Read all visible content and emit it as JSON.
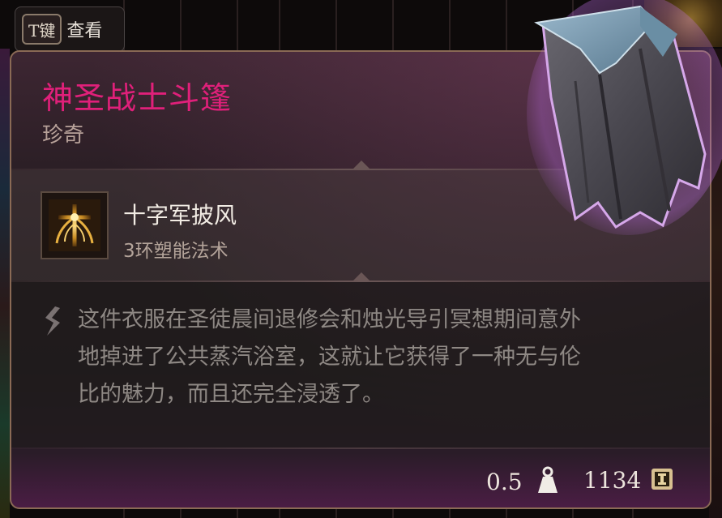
{
  "key_hint": {
    "key": "T键",
    "action": "查看"
  },
  "item": {
    "name": "神圣战士斗篷",
    "rarity": "珍奇",
    "name_color": "#e0207a"
  },
  "spell": {
    "name": "十字军披风",
    "type": "3环塑能法术",
    "icon": "crusader-mantle-spell-icon"
  },
  "description": {
    "lines": [
      "这件衣服在圣徒晨间退修会和烛光导引冥想期间意外",
      "地掉进了公共蒸汽浴室，这就让它获得了一种无与伦",
      "比的魅力，而且还完全浸透了。"
    ]
  },
  "stats": {
    "weight": "0.5",
    "weight_icon": "weight-icon",
    "value": "1134",
    "value_icon": "gold-coin-icon"
  }
}
